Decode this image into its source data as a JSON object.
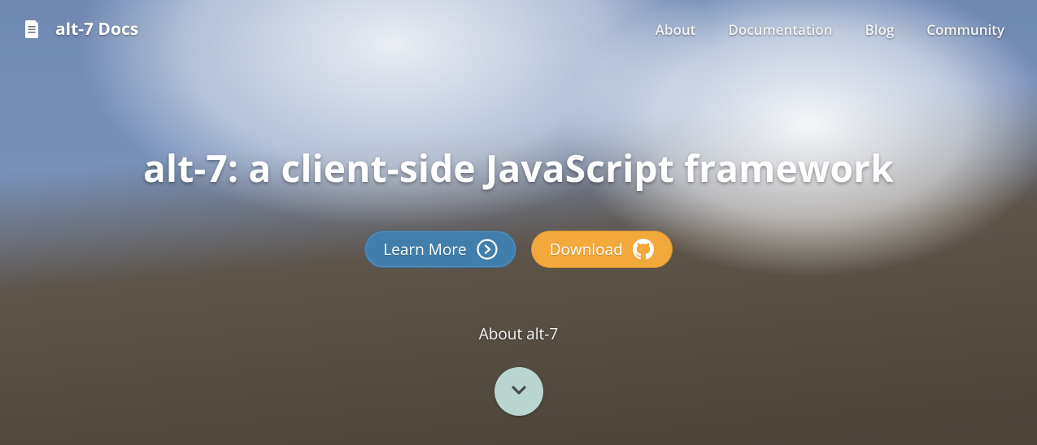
{
  "brand": {
    "title": "alt-7 Docs"
  },
  "nav": {
    "items": [
      {
        "label": "About"
      },
      {
        "label": "Documentation"
      },
      {
        "label": "Blog"
      },
      {
        "label": "Community"
      }
    ]
  },
  "hero": {
    "headline": "alt-7: a client-side JavaScript framework",
    "learn_more_label": "Learn More",
    "download_label": "Download",
    "about_label": "About alt-7"
  },
  "colors": {
    "primary_button": "#417eac",
    "secondary_button": "#f2a83b",
    "scroll_disc": "#b8d6cf"
  }
}
